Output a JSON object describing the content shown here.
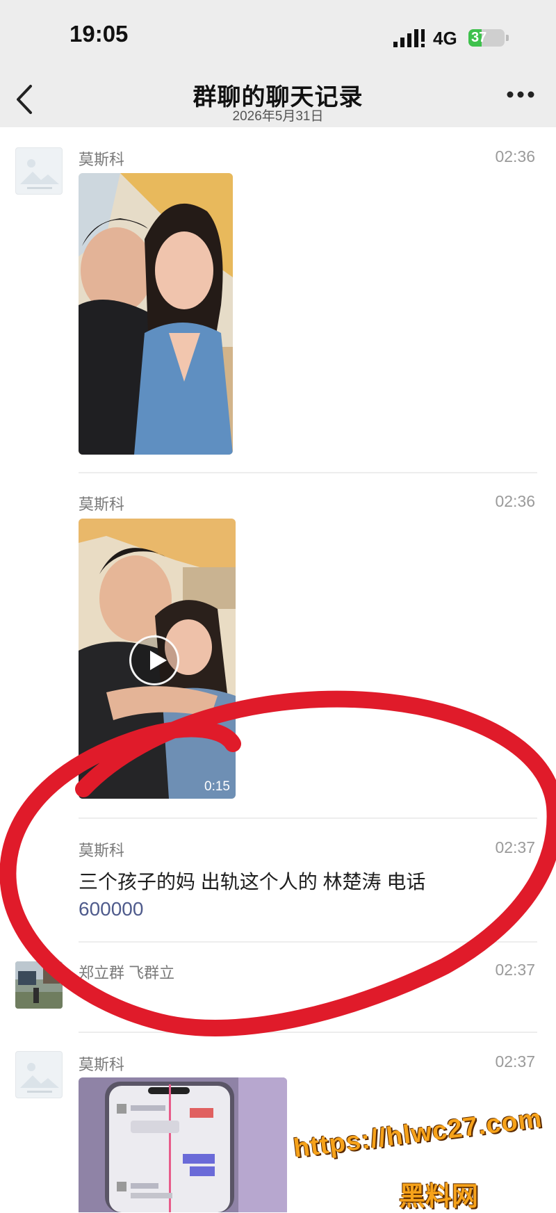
{
  "status_bar": {
    "time": "19:05",
    "network": "4G",
    "battery": "37",
    "battery_level": 0.37
  },
  "nav": {
    "title": "群聊的聊天记录",
    "date": "2026年5月31日"
  },
  "messages": [
    {
      "sender": "莫斯科",
      "time": "02:36",
      "type": "image"
    },
    {
      "sender": "莫斯科",
      "time": "02:36",
      "type": "video",
      "duration": "0:15"
    },
    {
      "sender": "莫斯科",
      "time": "02:37",
      "type": "text",
      "line1": "三个孩子的妈 出轨这个人的 林楚涛 电话",
      "line2": "600000"
    },
    {
      "sender": "郑立群 飞群立",
      "time": "02:37",
      "type": "text",
      "line1": ""
    },
    {
      "sender": "莫斯科",
      "time": "02:37",
      "type": "image"
    }
  ],
  "watermark": {
    "url": "https://hlwc27.com",
    "site": "黑料网"
  },
  "colors": {
    "annotation_circle": "#e01b2a",
    "watermark": "#f6a21a"
  }
}
